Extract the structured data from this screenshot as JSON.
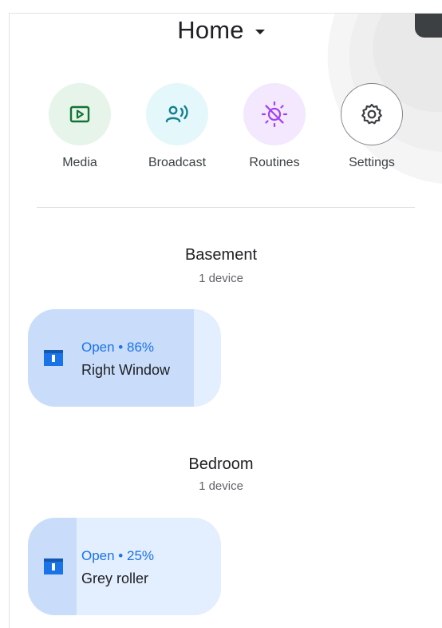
{
  "header": {
    "title": "Home",
    "caret_icon": "caret-down-icon"
  },
  "quick_actions": [
    {
      "label": "Media",
      "icon": "play-box-icon",
      "bg": "#e6f4ea",
      "color": "#137333"
    },
    {
      "label": "Broadcast",
      "icon": "broadcast-person-icon",
      "bg": "#e4f7fb",
      "color": "#12818f"
    },
    {
      "label": "Routines",
      "icon": "sun-slash-icon",
      "bg": "#f3e8fd",
      "color": "#a142f4"
    },
    {
      "label": "Settings",
      "icon": "gear-icon",
      "bg": "#ffffff",
      "color": "#3c4043"
    }
  ],
  "rooms": [
    {
      "name": "Basement",
      "device_count": "1 device",
      "devices": [
        {
          "status": "Open • 86%",
          "name": "Right Window",
          "level": 0.86,
          "icon": "window-blind-icon"
        }
      ]
    },
    {
      "name": "Bedroom",
      "device_count": "1 device",
      "devices": [
        {
          "status": "Open • 25%",
          "name": "Grey roller",
          "level": 0.25,
          "icon": "window-blind-icon"
        }
      ]
    }
  ],
  "colors": {
    "accent": "#1a73e8",
    "tile_bg": "#e3eefe",
    "tile_fill": "#c9ddfb"
  }
}
